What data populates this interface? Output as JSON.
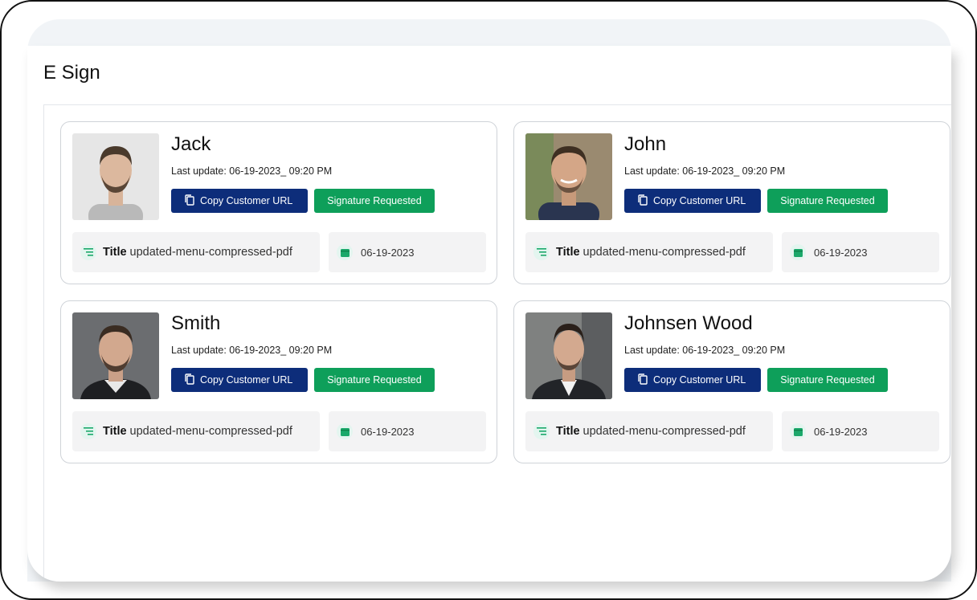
{
  "page": {
    "title": "E Sign"
  },
  "colors": {
    "primary_button": "#0d2d7a",
    "status_button": "#0e9f5a",
    "icon_accent": "#1aa86a"
  },
  "cards": [
    {
      "name": "Jack",
      "last_update": "Last update: 06-19-2023_ 09:20 PM",
      "copy_label": "Copy Customer URL",
      "status_label": "Signature Requested",
      "title_label": "Title",
      "title_value": "updated-menu-compressed-pdf",
      "date": "06-19-2023"
    },
    {
      "name": "John",
      "last_update": "Last update: 06-19-2023_ 09:20 PM",
      "copy_label": "Copy Customer URL",
      "status_label": "Signature Requested",
      "title_label": "Title",
      "title_value": "updated-menu-compressed-pdf",
      "date": "06-19-2023"
    },
    {
      "name": "Smith",
      "last_update": "Last update: 06-19-2023_ 09:20 PM",
      "copy_label": "Copy Customer URL",
      "status_label": "Signature Requested",
      "title_label": "Title",
      "title_value": "updated-menu-compressed-pdf",
      "date": "06-19-2023"
    },
    {
      "name": "Johnsen Wood",
      "last_update": "Last update: 06-19-2023_ 09:20 PM",
      "copy_label": "Copy Customer URL",
      "status_label": "Signature Requested",
      "title_label": "Title",
      "title_value": "updated-menu-compressed-pdf",
      "date": "06-19-2023"
    }
  ],
  "icons": {
    "copy": "copy-icon",
    "title": "list-lines-icon",
    "date": "calendar-icon"
  }
}
